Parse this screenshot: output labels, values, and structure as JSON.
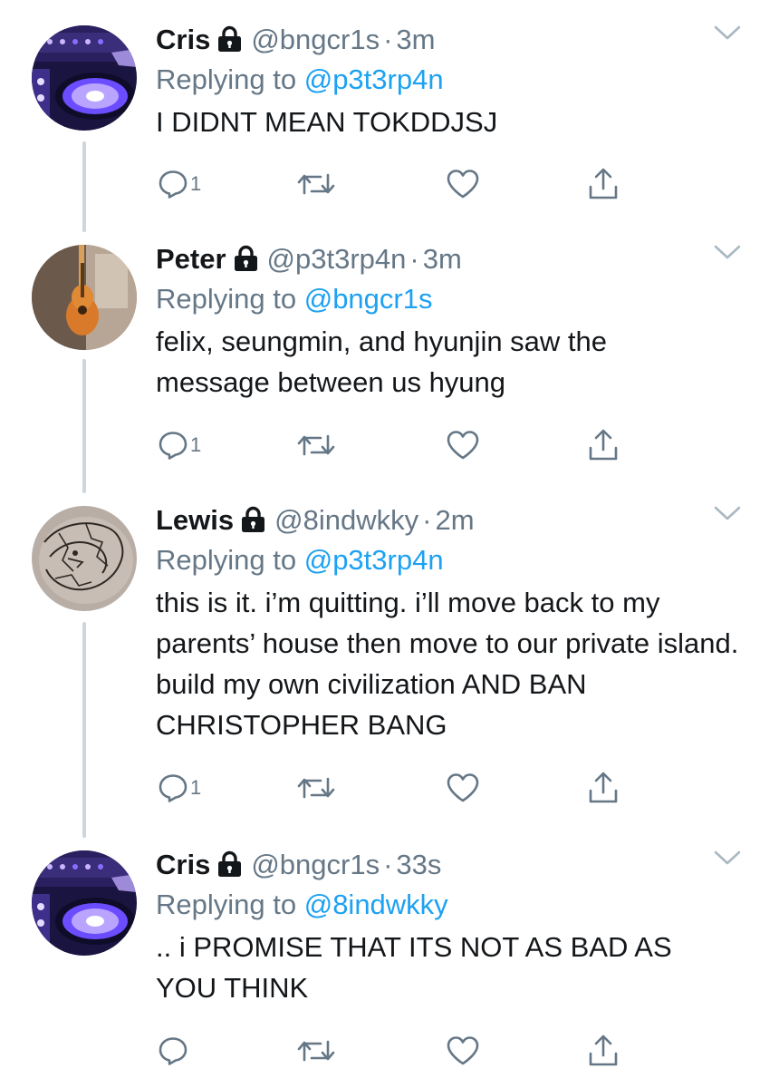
{
  "tweets": [
    {
      "name": "Cris",
      "handle": "@bngcr1s",
      "separator": "·",
      "time": "3m",
      "replying_prefix": "Replying to",
      "replying_to": "@p3t3rp4n",
      "text": "I DIDNT MEAN TOKDDJSJ",
      "reply_count": "1"
    },
    {
      "name": "Peter",
      "handle": "@p3t3rp4n",
      "separator": "·",
      "time": "3m",
      "replying_prefix": "Replying to",
      "replying_to": "@bngcr1s",
      "text": "felix, seungmin, and hyunjin saw the message between us hyung",
      "reply_count": "1"
    },
    {
      "name": "Lewis",
      "handle": "@8indwkky",
      "separator": "·",
      "time": "2m",
      "replying_prefix": "Replying to",
      "replying_to": "@p3t3rp4n",
      "text": "this is it. i’m quitting. i’ll move back to my parents’ house then move to our private island. build my own civilization AND BAN CHRISTOPHER BANG",
      "reply_count": "1"
    },
    {
      "name": "Cris",
      "handle": "@bngcr1s",
      "separator": "·",
      "time": "33s",
      "replying_prefix": "Replying to",
      "replying_to": "@8indwkky",
      "text": ".. i PROMISE THAT ITS NOT AS BAD AS YOU THINK",
      "reply_count": ""
    }
  ],
  "icons": {
    "protected": "lock-icon",
    "menu": "chevron-down-icon",
    "reply": "reply-icon",
    "retweet": "retweet-icon",
    "like": "heart-icon",
    "share": "share-icon"
  },
  "colors": {
    "link": "#1da1f2",
    "secondary_text": "#657786",
    "thread_line": "#ccd6dd",
    "primary_text": "#14171a"
  }
}
